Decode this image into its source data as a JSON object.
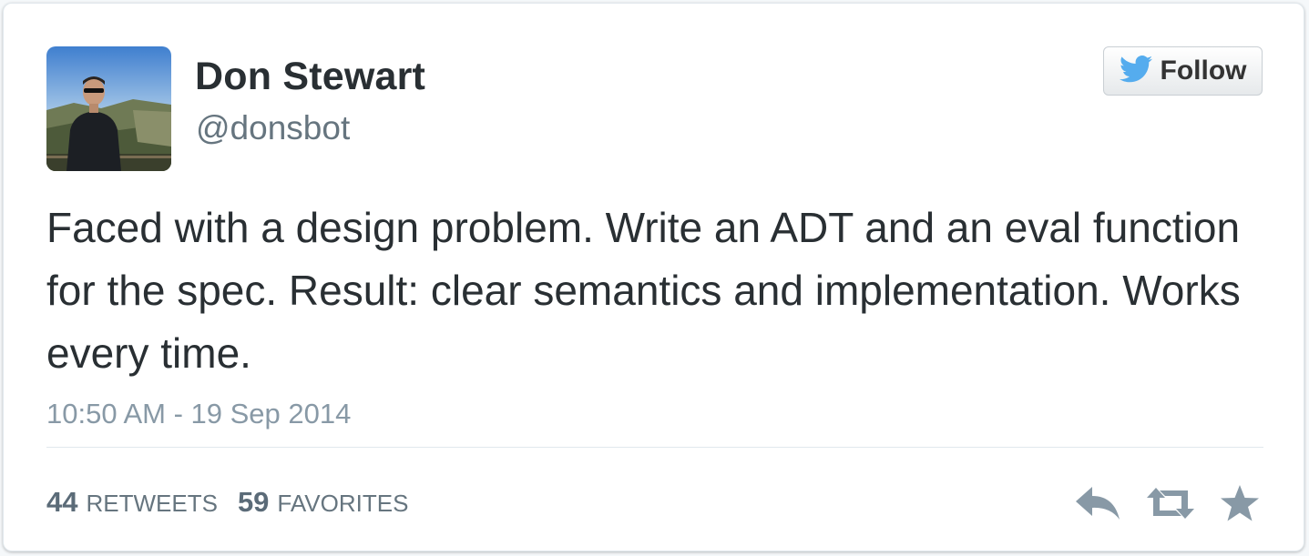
{
  "user": {
    "name": "Don Stewart",
    "handle": "@donsbot"
  },
  "follow_button": {
    "label": "Follow",
    "icon": "twitter-bird-icon"
  },
  "tweet": {
    "text": "Faced with a design problem. Write an ADT and an eval function for the spec. Result: clear semantics and implementation. Works every time.",
    "timestamp": "10:50 AM - 19 Sep 2014"
  },
  "stats": {
    "retweets_count": "44",
    "retweets_label": "RETWEETS",
    "favorites_count": "59",
    "favorites_label": "FAVORITES"
  },
  "actions": [
    "reply-icon",
    "retweet-icon",
    "favorite-star-icon"
  ],
  "colors": {
    "text": "#292f33",
    "muted": "#8899a6",
    "twitter_blue": "#55acee",
    "action_gray": "#8899a6"
  }
}
